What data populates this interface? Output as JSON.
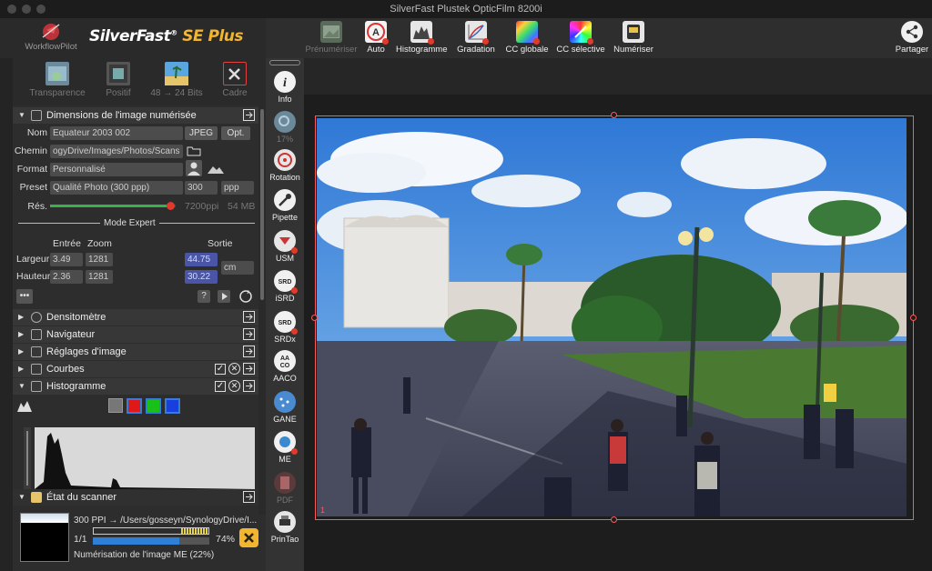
{
  "window": {
    "title": "SilverFast  Plustek OpticFilm 8200i"
  },
  "header": {
    "workflow_label": "WorkflowPilot",
    "brand": "SilverFast",
    "brand_reg": "®",
    "brand_edition": "SE Plus"
  },
  "toolbar": {
    "items": [
      {
        "label": "Prénumériser",
        "icon": "prescan-icon"
      },
      {
        "label": "Auto",
        "icon": "auto-icon"
      },
      {
        "label": "Histogramme",
        "icon": "histogram-icon"
      },
      {
        "label": "Gradation",
        "icon": "gradation-icon"
      },
      {
        "label": "CC globale",
        "icon": "color-correction-icon"
      },
      {
        "label": "CC sélective",
        "icon": "selective-color-icon"
      },
      {
        "label": "Numériser",
        "icon": "scan-icon"
      }
    ],
    "share_label": "Partager"
  },
  "modes": [
    {
      "label": "Transparence"
    },
    {
      "label": "Positif"
    },
    {
      "label": "48 → 24 Bits"
    },
    {
      "label": "Cadre"
    }
  ],
  "dimensions": {
    "section_title": "Dimensions de l'image numérisée",
    "name_label": "Nom",
    "name_value": "Equateur 2003 002",
    "format_type": "JPEG",
    "opt_label": "Opt.",
    "path_label": "Chemin",
    "path_value": "ogyDrive/Images/Photos/Scans",
    "format_label": "Format",
    "format_value": "Personnalisé",
    "preset_label": "Preset",
    "preset_value": "Qualité Photo (300 ppp)",
    "preset_res": "300",
    "preset_unit": "ppp",
    "res_label": "Rés.",
    "res_value": "7200ppi",
    "file_size": "54 MB",
    "res_fraction": 0.96
  },
  "expert": {
    "title": "Mode Expert",
    "col_input": "Entrée",
    "col_zoom": "Zoom",
    "col_output": "Sortie",
    "width_label": "Largeur",
    "width_in": "3.49",
    "width_zoom": "1281",
    "width_out": "44.75",
    "height_label": "Hauteur",
    "height_in": "2.36",
    "height_zoom": "1281",
    "height_out": "30.22",
    "unit": "cm",
    "more": "•••"
  },
  "sections": [
    {
      "label": "Densitomètre"
    },
    {
      "label": "Navigateur"
    },
    {
      "label": "Réglages d'image"
    },
    {
      "label": "Courbes"
    },
    {
      "label": "Histogramme"
    }
  ],
  "scanner": {
    "title": "État du scanner",
    "line1": "300 PPI → /Users/gosseyn/SynologyDrive/I...",
    "count": "1/1",
    "percent": "74%",
    "progress": 0.74,
    "status": "Numérisation de l'image ME (22%)"
  },
  "vtools": [
    {
      "label": "Info"
    },
    {
      "label": "17%"
    },
    {
      "label": "Rotation"
    },
    {
      "label": "Pipette"
    },
    {
      "label": "USM"
    },
    {
      "label": "iSRD"
    },
    {
      "label": "SRDx"
    },
    {
      "label": "AACO"
    },
    {
      "label": "GANE"
    },
    {
      "label": "ME"
    },
    {
      "label": "PDF"
    },
    {
      "label": "PrinTao"
    }
  ],
  "preview": {
    "frame_number": "1"
  },
  "colors": {
    "accent_red": "#ff5a5a",
    "brand_yellow": "#f2b530",
    "progress_blue": "#2f7fd6"
  }
}
